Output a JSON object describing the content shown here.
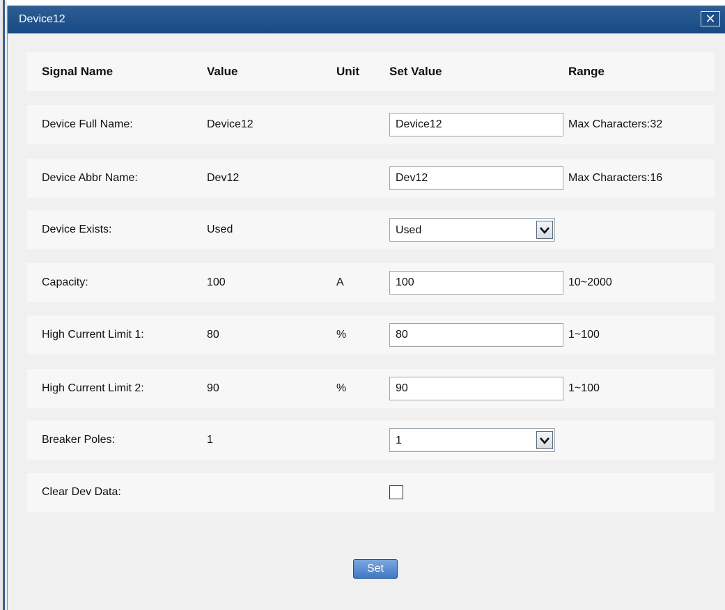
{
  "window": {
    "title": "Device12",
    "close_label": "✕"
  },
  "table": {
    "headers": {
      "signal_name": "Signal Name",
      "value": "Value",
      "unit": "Unit",
      "set_value": "Set Value",
      "range": "Range"
    },
    "rows": [
      {
        "label": "Device Full Name:",
        "value": "Device12",
        "unit": "",
        "set_value": "Device12",
        "control": "text",
        "range": "Max Characters:32"
      },
      {
        "label": "Device Abbr Name:",
        "value": "Dev12",
        "unit": "",
        "set_value": "Dev12",
        "control": "text",
        "range": "Max Characters:16"
      },
      {
        "label": "Device Exists:",
        "value": "Used",
        "unit": "",
        "set_value": "Used",
        "control": "select",
        "range": ""
      },
      {
        "label": "Capacity:",
        "value": "100",
        "unit": "A",
        "set_value": "100",
        "control": "text",
        "range": "10~2000"
      },
      {
        "label": "High Current Limit 1:",
        "value": "80",
        "unit": "%",
        "set_value": "80",
        "control": "text",
        "range": "1~100"
      },
      {
        "label": "High Current Limit 2:",
        "value": "90",
        "unit": "%",
        "set_value": "90",
        "control": "text",
        "range": "1~100"
      },
      {
        "label": "Breaker Poles:",
        "value": "1",
        "unit": "",
        "set_value": "1",
        "control": "select",
        "range": ""
      },
      {
        "label": "Clear Dev Data:",
        "value": "",
        "unit": "",
        "set_value": "",
        "control": "checkbox",
        "checked": false,
        "range": ""
      }
    ]
  },
  "actions": {
    "set_label": "Set"
  },
  "colors": {
    "titlebar": "#1d4f8a",
    "panel": "#f7f7f7",
    "dialog": "#f0f0f0",
    "button": "#4a82cc"
  }
}
